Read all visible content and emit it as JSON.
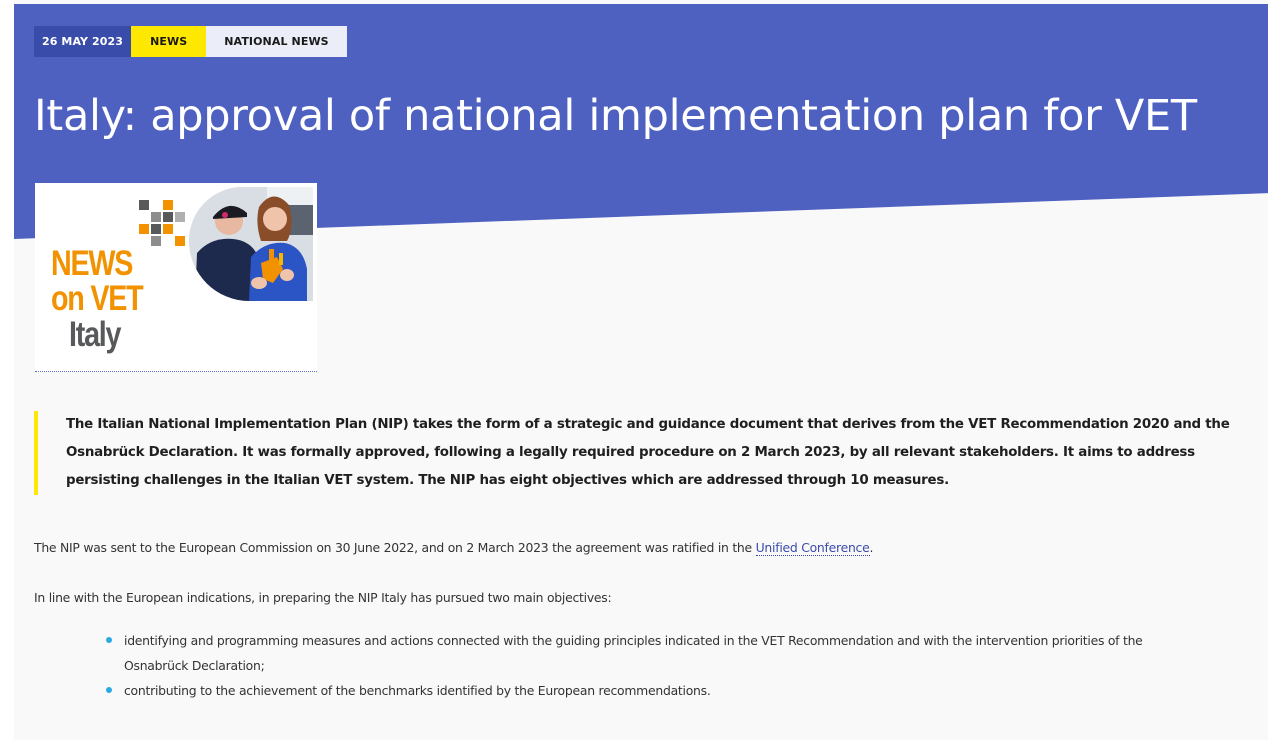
{
  "colors": {
    "hero": "#4e60c0",
    "date_tag": "#3a4ca9",
    "news_tag": "#ffe800",
    "national_tag": "#ebeef8",
    "lead_border": "#ffe800",
    "link": "#3a4ca9",
    "bullet": "#2aa8e0",
    "news_orange": "#f39200",
    "news_grey": "#58595b"
  },
  "article": {
    "date": "26 MAY 2023",
    "tags": [
      "NEWS",
      "NATIONAL NEWS"
    ],
    "title": "Italy: approval of national implementation plan for VET",
    "image": {
      "line1": "NEWS",
      "line2": "on VET",
      "line3": "Italy"
    },
    "lead": [
      "The Italian National Implementation Plan (NIP) takes the form of a strategic and guidance document that derives from the VET Recommendation 2020 and the",
      "Osnabrück Declaration. It was formally approved, following a legally required procedure on 2 March 2023, by all relevant stakeholders. It aims to address",
      "persisting challenges in the Italian VET system. The NIP has eight objectives which are addressed through 10 measures."
    ],
    "para1": {
      "text": "The NIP was sent to the European Commission on 30 June 2022, and on 2 March 2023 the agreement was ratified in the ",
      "link": "Unified Conference",
      "end": "."
    },
    "para2": "In line with the European indications, in preparing the NIP Italy has pursued two main objectives:",
    "bullets": [
      {
        "line1": "identifying and programming measures and actions connected with the guiding principles indicated in the VET Recommendation and with the intervention priorities of the",
        "line2": "Osnabrück Declaration;"
      },
      {
        "line1": "contributing to the achievement of the benchmarks identified by the European recommendations."
      }
    ]
  }
}
